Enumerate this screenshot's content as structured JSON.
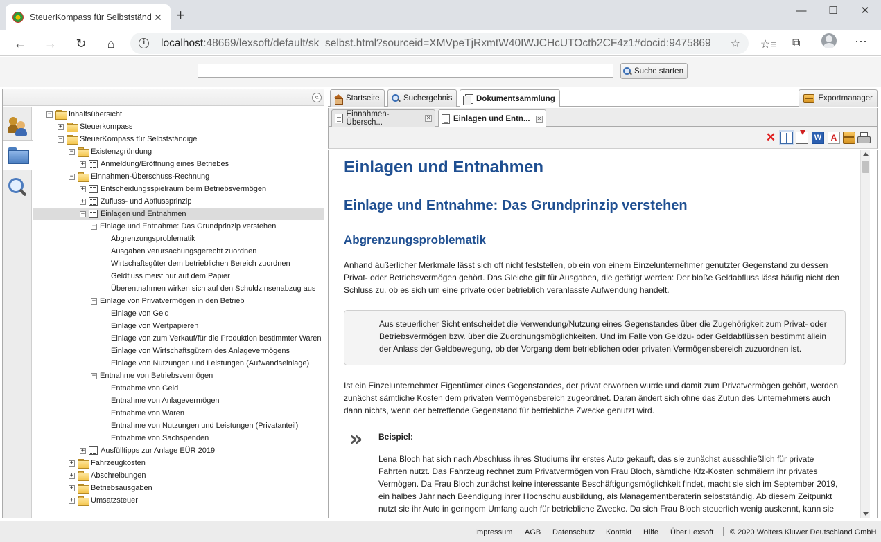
{
  "browser": {
    "tab_title": "SteuerKompass für Selbstständige",
    "url_host": "localhost",
    "url_rest": ":48669/lexsoft/default/sk_selbst.html?sourceid=XMVpeTjRxmtW40IWJCHcUTOctb2CF4z1#docid:9475869",
    "icons": [
      "back-icon",
      "forward-icon",
      "reload-icon",
      "home-icon",
      "info-icon",
      "star-icon",
      "favorites-icon",
      "collections-icon",
      "profile-icon",
      "more-icon"
    ]
  },
  "search": {
    "value": "",
    "button_label": "Suche starten"
  },
  "tree": [
    {
      "label": "Inhaltsübersicht",
      "type": "folder",
      "exp": "−"
    },
    {
      "label": "Steuerkompass",
      "type": "folder",
      "exp": "+"
    },
    {
      "label": "SteuerKompass für Selbstständige",
      "type": "folder",
      "exp": "−"
    },
    {
      "label": "Existenzgründung",
      "type": "folder",
      "exp": "−"
    },
    {
      "label": "Anmeldung/Eröffnung eines Betriebes",
      "type": "doc",
      "exp": "+"
    },
    {
      "label": "Einnahmen-Überschuss-Rechnung",
      "type": "folder",
      "exp": "−"
    },
    {
      "label": "Entscheidungsspielraum beim Betriebsvermögen",
      "type": "doc",
      "exp": "+"
    },
    {
      "label": "Zufluss- und Abflussprinzip",
      "type": "doc",
      "exp": "+"
    },
    {
      "label": "Einlagen und Entnahmen",
      "type": "doc",
      "exp": "−",
      "selected": true
    },
    {
      "label": "Einlage und Entnahme: Das Grundprinzip verstehen",
      "type": "none",
      "exp": "−"
    },
    {
      "label": "Abgrenzungsproblematik",
      "type": "none",
      "exp": ""
    },
    {
      "label": "Ausgaben verursachungsgerecht zuordnen",
      "type": "none",
      "exp": ""
    },
    {
      "label": "Wirtschaftsgüter dem betrieblichen Bereich zuordnen",
      "type": "none",
      "exp": ""
    },
    {
      "label": "Geldfluss meist nur auf dem Papier",
      "type": "none",
      "exp": ""
    },
    {
      "label": "Überentnahmen wirken sich auf den Schuldzinsenabzug aus",
      "type": "none",
      "exp": ""
    },
    {
      "label": "Einlage von Privatvermögen in den Betrieb",
      "type": "none",
      "exp": "−"
    },
    {
      "label": "Einlage von Geld",
      "type": "none",
      "exp": ""
    },
    {
      "label": "Einlage von Wertpapieren",
      "type": "none",
      "exp": ""
    },
    {
      "label": "Einlage von zum Verkauf/für die Produktion bestimmter Waren",
      "type": "none",
      "exp": ""
    },
    {
      "label": "Einlage von Wirtschaftsgütern des Anlagevermögens",
      "type": "none",
      "exp": ""
    },
    {
      "label": "Einlage von Nutzungen und Leistungen (Aufwandseinlage)",
      "type": "none",
      "exp": ""
    },
    {
      "label": "Entnahme von Betriebsvermögen",
      "type": "none",
      "exp": "−"
    },
    {
      "label": "Entnahme von Geld",
      "type": "none",
      "exp": ""
    },
    {
      "label": "Entnahme von Anlagevermögen",
      "type": "none",
      "exp": ""
    },
    {
      "label": "Entnahme von Waren",
      "type": "none",
      "exp": ""
    },
    {
      "label": "Entnahme von Nutzungen und Leistungen (Privatanteil)",
      "type": "none",
      "exp": ""
    },
    {
      "label": "Entnahme von Sachspenden",
      "type": "none",
      "exp": ""
    },
    {
      "label": "Ausfülltipps zur Anlage EÜR 2019",
      "type": "doc",
      "exp": "+"
    },
    {
      "label": "Fahrzeugkosten",
      "type": "folder",
      "exp": "+"
    },
    {
      "label": "Abschreibungen",
      "type": "folder",
      "exp": "+"
    },
    {
      "label": "Betriebsausgaben",
      "type": "folder",
      "exp": "+"
    },
    {
      "label": "Umsatzsteuer",
      "type": "folder",
      "exp": "+"
    }
  ],
  "main_tabs": {
    "start": "Startseite",
    "results": "Suchergebnis",
    "collection": "Dokumentsammlung",
    "export": "Exportmanager"
  },
  "doc_tabs": {
    "tab1": "Einnahmen-Übersch...",
    "tab2": "Einlagen und Entn...",
    "close": "✕"
  },
  "document": {
    "h1": "Einlagen und Entnahmen",
    "h2": "Einlage und Entnahme: Das Grundprinzip verstehen",
    "h3": "Abgrenzungsproblematik",
    "p1": "Anhand äußerlicher Merkmale lässt sich oft nicht feststellen, ob ein von einem Einzelunternehmer genutzter Gegenstand zu dessen Privat- oder Betriebsvermögen gehört. Das Gleiche gilt für Ausgaben, die getätigt werden: Der bloße Geldabfluss lässt häufig nicht den Schluss zu, ob es sich um eine private oder betrieblich veranlasste Aufwendung handelt.",
    "box": "Aus steuerlicher Sicht entscheidet die Verwendung/Nutzung eines Gegenstandes über die Zugehörigkeit zum Privat- oder Betriebsvermögen bzw. über die Zuordnungsmöglichkeiten. Und im Falle von Geldzu- oder Geldabflüssen bestimmt allein der Anlass der Geldbewegung, ob der Vorgang dem betrieblichen oder privaten Vermögensbereich zuzuordnen ist.",
    "p2": "Ist ein Einzelunternehmer Eigentümer eines Gegenstandes, der privat erworben wurde und damit zum Privatvermögen gehört, werden zunächst sämtliche Kosten dem privaten Vermögensbereich zugeordnet. Daran ändert sich ohne das Zutun des Unternehmers auch dann nichts, wenn der betreffende Gegenstand für betriebliche Zwecke genutzt wird.",
    "example_label": "Beispiel:",
    "example": "Lena Bloch hat sich nach Abschluss ihres Studiums ihr erstes Auto gekauft, das sie zunächst ausschließlich für private Fahrten nutzt. Das Fahrzeug rechnet zum Privatvermögen von Frau Bloch, sämtliche Kfz-Kosten schmälern ihr privates Vermögen. Da Frau Bloch zunächst keine interessante Beschäftigungsmöglichkeit findet, macht sie sich im September 2019, ein halbes Jahr nach Beendigung ihrer Hochschulausbildung, als Managementberaterin selbstständig. Ab diesem Zeitpunkt nutzt sie ihr Auto in geringem Umfang auch für betriebliche Zwecke. Da sich Frau Bloch steuerlich wenig auskennt, kann sie nicht erkennen, dass sie das Auto auch für ihre betrieblichen Zwecke nutzen kann."
  },
  "footer": {
    "links": [
      "Impressum",
      "AGB",
      "Datenschutz",
      "Kontakt",
      "Hilfe",
      "Über Lexsoft"
    ],
    "copyright": "© 2020 Wolters Kluwer Deutschland GmbH"
  }
}
